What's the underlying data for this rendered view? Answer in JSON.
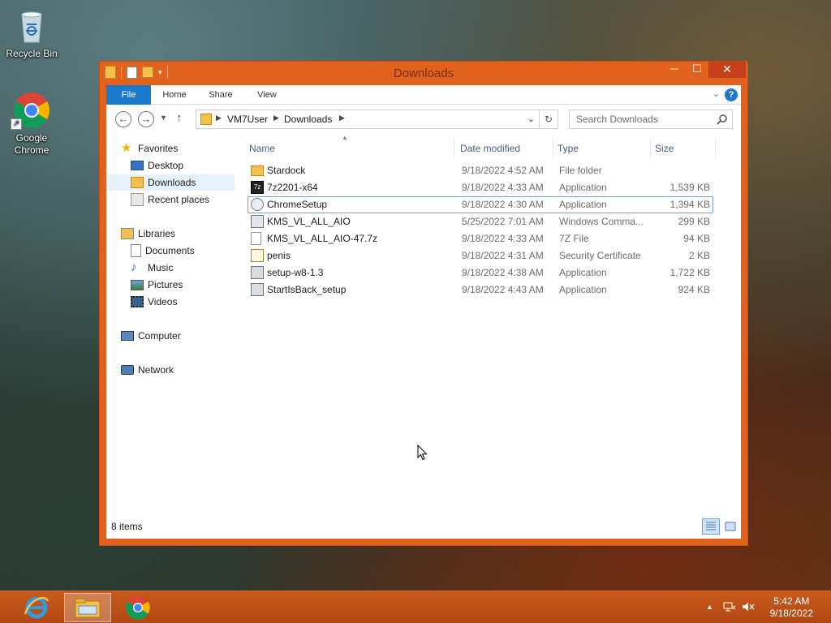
{
  "desktop": {
    "icons": [
      {
        "label": "Recycle Bin"
      },
      {
        "label": "Google Chrome"
      }
    ]
  },
  "window": {
    "title": "Downloads",
    "controls": {
      "minimize": "─",
      "maximize": "☐",
      "close": "✕"
    }
  },
  "ribbon": {
    "tabs": [
      "File",
      "Home",
      "Share",
      "View"
    ]
  },
  "address": {
    "path": [
      "VM7User",
      "Downloads"
    ]
  },
  "search": {
    "placeholder": "Search Downloads"
  },
  "nav": {
    "favorites": "Favorites",
    "desktop": "Desktop",
    "downloads": "Downloads",
    "recent": "Recent places",
    "libraries": "Libraries",
    "documents": "Documents",
    "music": "Music",
    "pictures": "Pictures",
    "videos": "Videos",
    "computer": "Computer",
    "network": "Network"
  },
  "columns": {
    "name": "Name",
    "date": "Date modified",
    "type": "Type",
    "size": "Size"
  },
  "files": [
    {
      "name": "Stardock",
      "date": "9/18/2022 4:52 AM",
      "type": "File folder",
      "size": ""
    },
    {
      "name": "7z2201-x64",
      "date": "9/18/2022 4:33 AM",
      "type": "Application",
      "size": "1,539 KB"
    },
    {
      "name": "ChromeSetup",
      "date": "9/18/2022 4:30 AM",
      "type": "Application",
      "size": "1,394 KB"
    },
    {
      "name": "KMS_VL_ALL_AIO",
      "date": "5/25/2022 7:01 AM",
      "type": "Windows Comma...",
      "size": "299 KB"
    },
    {
      "name": "KMS_VL_ALL_AIO-47.7z",
      "date": "9/18/2022 4:33 AM",
      "type": "7Z File",
      "size": "94 KB"
    },
    {
      "name": "penis",
      "date": "9/18/2022 4:31 AM",
      "type": "Security Certificate",
      "size": "2 KB"
    },
    {
      "name": "setup-w8-1.3",
      "date": "9/18/2022 4:38 AM",
      "type": "Application",
      "size": "1,722 KB"
    },
    {
      "name": "StartIsBack_setup",
      "date": "9/18/2022 4:43 AM",
      "type": "Application",
      "size": "924 KB"
    }
  ],
  "status": {
    "count": "8 items"
  },
  "taskbar": {
    "time": "5:42 AM",
    "date": "9/18/2022"
  },
  "colors": {
    "window_frame": "#e2621d",
    "file_tab": "#1979ca",
    "taskbar": "#b24712"
  }
}
